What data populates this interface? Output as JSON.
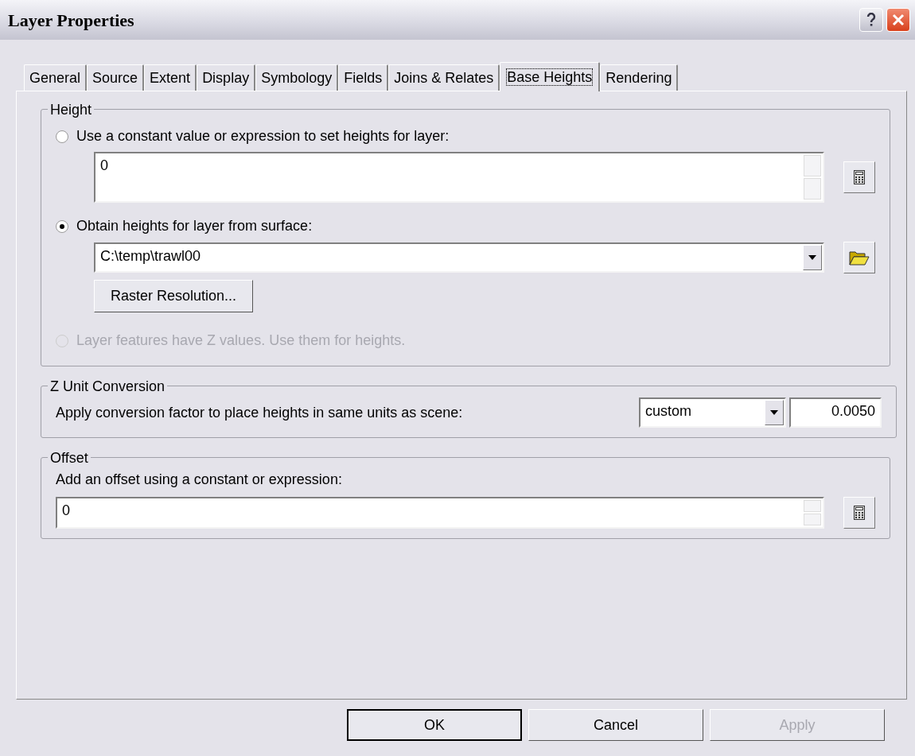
{
  "window": {
    "title": "Layer Properties"
  },
  "tabs": [
    {
      "label": "General",
      "selected": false
    },
    {
      "label": "Source",
      "selected": false
    },
    {
      "label": "Extent",
      "selected": false
    },
    {
      "label": "Display",
      "selected": false
    },
    {
      "label": "Symbology",
      "selected": false
    },
    {
      "label": "Fields",
      "selected": false
    },
    {
      "label": "Joins & Relates",
      "selected": false
    },
    {
      "label": "Base Heights",
      "selected": true
    },
    {
      "label": "Rendering",
      "selected": false
    }
  ],
  "height_group": {
    "legend": "Height",
    "options": [
      {
        "kind": "expression",
        "label": "Use a constant value or expression to set heights for layer:",
        "selected": false,
        "disabled": false,
        "value": "0"
      },
      {
        "kind": "surface",
        "label": "Obtain heights for layer from surface:",
        "selected": true,
        "disabled": false,
        "value": "C:\\temp\\trawl00",
        "button": "Raster Resolution..."
      },
      {
        "kind": "plain",
        "label": "Layer features have Z values.  Use them for heights.",
        "selected": false,
        "disabled": true
      }
    ]
  },
  "z_unit_group": {
    "legend": "Z Unit Conversion",
    "label": "Apply conversion factor to place heights in same units as scene:",
    "unit": "custom",
    "factor": "0.0050"
  },
  "offset_group": {
    "legend": "Offset",
    "label": "Add an offset using a constant or expression:",
    "value": "0"
  },
  "buttons": [
    {
      "label": "OK",
      "disabled": false,
      "default": true
    },
    {
      "label": "Cancel",
      "disabled": false,
      "default": false
    },
    {
      "label": "Apply",
      "disabled": true,
      "default": false
    }
  ]
}
